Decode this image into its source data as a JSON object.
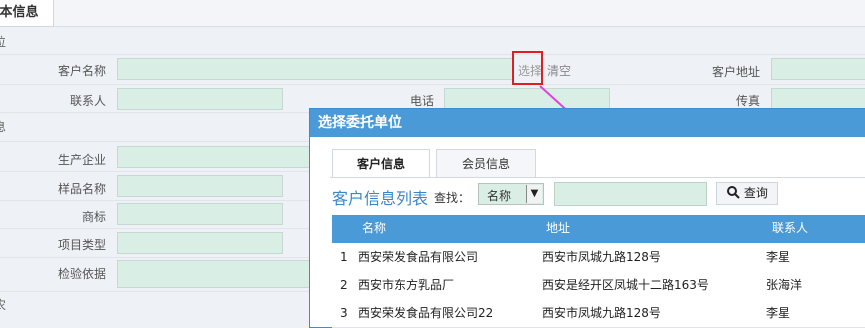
{
  "tab_basic_label": "本信息",
  "sections": {
    "s1": "位",
    "s2": "息",
    "s3": "农"
  },
  "form": {
    "customer_name_label": "客户名称",
    "select_link": "选择",
    "clear_link": "清空",
    "customer_address_label": "客户地址",
    "contact_label": "联系人",
    "phone_label": "电话",
    "fax_label": "传真",
    "producer_label": "生产企业",
    "sample_name_label": "样品名称",
    "trademark_label": "商标",
    "project_type_label": "项目类型",
    "basis_label": "检验依据"
  },
  "dialog": {
    "title": "选择委托单位",
    "tabs": [
      "客户信息",
      "会员信息"
    ],
    "list_title": "客户信息列表",
    "search_label": "查找：",
    "select_value": "名称",
    "query_button": "查询",
    "columns": [
      "名称",
      "地址",
      "联系人"
    ],
    "rows": [
      {
        "index": "1",
        "name": "西安荣发食品有限公司",
        "address": "西安市凤城九路128号",
        "contact": "李星"
      },
      {
        "index": "2",
        "name": "西安市东方乳品厂",
        "address": "西安是经开区凤城十二路163号",
        "contact": "张海洋"
      },
      {
        "index": "3",
        "name": "西安荣发食品有限公司22",
        "address": "西安市凤城九路128号",
        "contact": "李星"
      }
    ]
  },
  "colors": {
    "accent": "#4a9ad8",
    "field_bg": "#d9efe6",
    "highlight": "#e02020",
    "arrow": "#e040e0"
  }
}
